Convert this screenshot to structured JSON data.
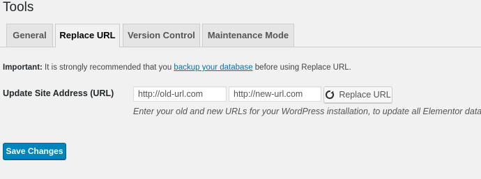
{
  "page": {
    "title": "Tools"
  },
  "tabs": [
    {
      "label": "General",
      "active": false
    },
    {
      "label": "Replace URL",
      "active": true
    },
    {
      "label": "Version Control",
      "active": false
    },
    {
      "label": "Maintenance Mode",
      "active": false
    }
  ],
  "notice": {
    "strong": "Important:",
    "text_before": " It is strongly recommended that you ",
    "link_text": "backup your database",
    "text_after": " before using Replace URL."
  },
  "replace_url": {
    "label": "Update Site Address (URL)",
    "old_url_placeholder": "http://old-url.com",
    "new_url_placeholder": "http://new-url.com",
    "button_label": "Replace URL",
    "button_icon": "refresh-icon",
    "description": "Enter your old and new URLs for your WordPress installation, to update all Elementor data"
  },
  "footer": {
    "save_label": "Save Changes"
  },
  "colors": {
    "background": "#f1f1f1",
    "link": "#0073aa",
    "primary_button": "#0085ba"
  }
}
